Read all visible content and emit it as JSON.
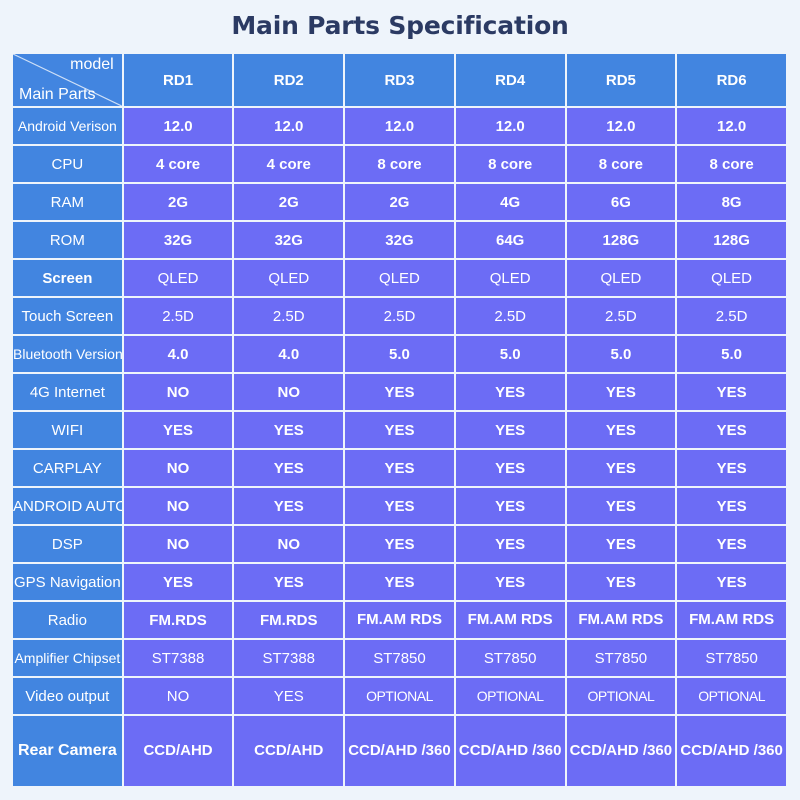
{
  "title": "Main Parts Specification",
  "corner": {
    "top_right_label": "model",
    "bottom_left_label": "Main Parts"
  },
  "columns": [
    "RD1",
    "RD2",
    "RD3",
    "RD4",
    "RD5",
    "RD6"
  ],
  "rows": [
    {
      "label": "Android Verison",
      "values": [
        "12.0",
        "12.0",
        "12.0",
        "12.0",
        "12.0",
        "12.0"
      ]
    },
    {
      "label": "CPU",
      "values": [
        "4 core",
        "4 core",
        "8 core",
        "8 core",
        "8 core",
        "8 core"
      ]
    },
    {
      "label": "RAM",
      "values": [
        "2G",
        "2G",
        "2G",
        "4G",
        "6G",
        "8G"
      ]
    },
    {
      "label": "ROM",
      "values": [
        "32G",
        "32G",
        "32G",
        "64G",
        "128G",
        "128G"
      ]
    },
    {
      "label": "Screen",
      "values": [
        "QLED",
        "QLED",
        "QLED",
        "QLED",
        "QLED",
        "QLED"
      ]
    },
    {
      "label": "Touch Screen",
      "values": [
        "2.5D",
        "2.5D",
        "2.5D",
        "2.5D",
        "2.5D",
        "2.5D"
      ]
    },
    {
      "label": "Bluetooth Version",
      "values": [
        "4.0",
        "4.0",
        "5.0",
        "5.0",
        "5.0",
        "5.0"
      ]
    },
    {
      "label": "4G Internet",
      "values": [
        "NO",
        "NO",
        "YES",
        "YES",
        "YES",
        "YES"
      ]
    },
    {
      "label": "WIFI",
      "values": [
        "YES",
        "YES",
        "YES",
        "YES",
        "YES",
        "YES"
      ]
    },
    {
      "label": "CARPLAY",
      "values": [
        "NO",
        "YES",
        "YES",
        "YES",
        "YES",
        "YES"
      ]
    },
    {
      "label": "ANDROID AUTO",
      "values": [
        "NO",
        "YES",
        "YES",
        "YES",
        "YES",
        "YES"
      ]
    },
    {
      "label": "DSP",
      "values": [
        "NO",
        "NO",
        "YES",
        "YES",
        "YES",
        "YES"
      ]
    },
    {
      "label": "GPS Navigation",
      "values": [
        "YES",
        "YES",
        "YES",
        "YES",
        "YES",
        "YES"
      ]
    },
    {
      "label": "Radio",
      "values": [
        "FM.RDS",
        "FM.RDS",
        "FM.AM\nRDS",
        "FM.AM\nRDS",
        "FM.AM\nRDS",
        "FM.AM\nRDS"
      ]
    },
    {
      "label": "Amplifier Chipset",
      "values": [
        "ST7388",
        "ST7388",
        "ST7850",
        "ST7850",
        "ST7850",
        "ST7850"
      ]
    },
    {
      "label": "Video output",
      "values": [
        "NO",
        "YES",
        "OPTIONAL",
        "OPTIONAL",
        "OPTIONAL",
        "OPTIONAL"
      ]
    },
    {
      "label": "Rear\nCamera",
      "values": [
        "CCD/AHD",
        "CCD/AHD",
        "CCD/AHD\n/360",
        "CCD/AHD\n/360",
        "CCD/AHD\n/360",
        "CCD/AHD\n/360"
      ]
    }
  ],
  "colors": {
    "page_background": "#eef4fb",
    "label_cell": "#4285e0",
    "header_cell": "#4285e0",
    "value_cell": "#6c6cf5",
    "title_text": "#2b3a63",
    "cell_text": "#ffffff"
  }
}
